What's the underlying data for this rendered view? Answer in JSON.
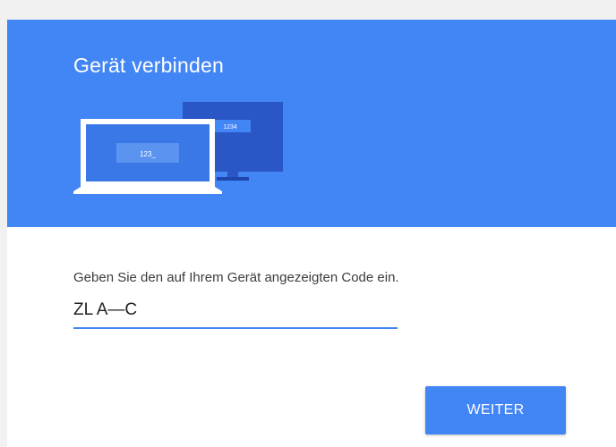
{
  "card": {
    "title": "Gerät verbinden"
  },
  "illustration": {
    "laptop_screen_text": "123_",
    "monitor_screen_text": "1234"
  },
  "form": {
    "prompt": "Geben Sie den auf Ihrem Gerät angezeigten Code ein.",
    "code_value": "ZL A—C"
  },
  "actions": {
    "continue_label": "WEITER"
  },
  "colors": {
    "accent": "#4285f4",
    "header_bg": "#4285f4",
    "device_dark": "#2a56c6",
    "device_light": "#ffffff"
  },
  "icons": {
    "laptop": "laptop-icon",
    "monitor": "monitor-icon"
  }
}
